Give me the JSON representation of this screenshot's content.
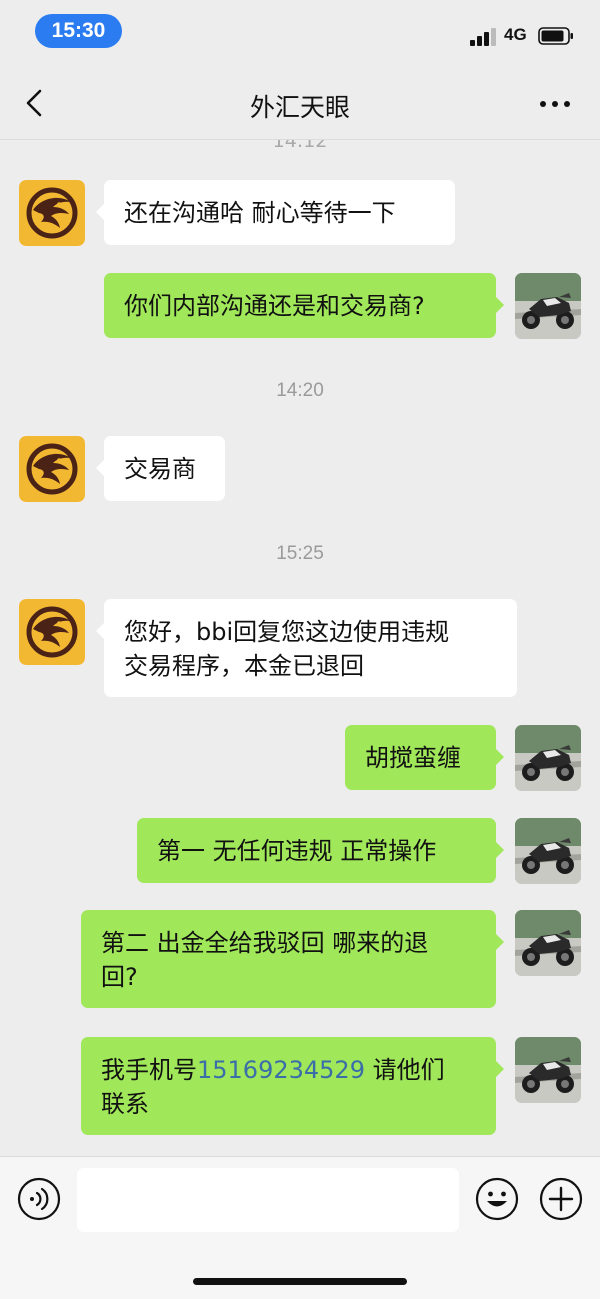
{
  "status_bar": {
    "time": "15:30",
    "network": "4G"
  },
  "nav": {
    "title": "外汇天眼",
    "back_icon": "chevron-left-icon",
    "more_icon": "more-dots-icon"
  },
  "chat": {
    "cut_timestamp": "14:12",
    "timestamps": [
      "14:20",
      "15:25"
    ],
    "messages": [
      {
        "side": "in",
        "text": "还在沟通哈 耐心等待一下"
      },
      {
        "side": "out",
        "text": "你们内部沟通还是和交易商?"
      },
      {
        "side": "in",
        "text": "交易商"
      },
      {
        "side": "in",
        "line1": "您好，bbi回复您这边使用违规",
        "line2": "交易程序，本金已退回"
      },
      {
        "side": "out",
        "text": "胡搅蛮缠"
      },
      {
        "side": "out",
        "text": "第一 无任何违规 正常操作"
      },
      {
        "side": "out",
        "line1": "第二 出金全给我驳回 哪来的退",
        "line2": "回?"
      },
      {
        "side": "out",
        "prefix": "我手机号",
        "phone": "15169234529",
        "suffix": " 请他们",
        "line2": "联系"
      }
    ]
  },
  "input_bar": {
    "voice_icon": "voice-icon",
    "emoji_icon": "emoji-icon",
    "plus_icon": "plus-icon",
    "input_value": ""
  },
  "colors": {
    "out_bubble": "#a0e75a",
    "in_bubble": "#ffffff",
    "background": "#ededed",
    "time_pill": "#2b7cf0",
    "phone_link": "#3a6ea8"
  }
}
